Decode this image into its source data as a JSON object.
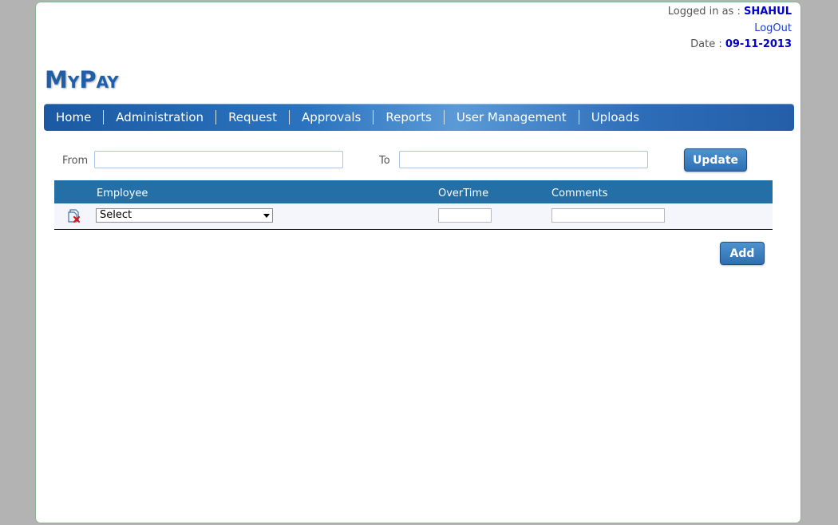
{
  "header": {
    "logged_in_label": "Logged in as : ",
    "username": "SHAHUL",
    "logout_label": "LogOut",
    "date_label": "Date : ",
    "date_value": "09-11-2013"
  },
  "logo": {
    "text": "MyPay"
  },
  "nav": {
    "items": [
      {
        "label": "Home"
      },
      {
        "label": "Administration"
      },
      {
        "label": "Request"
      },
      {
        "label": "Approvals"
      },
      {
        "label": "Reports"
      },
      {
        "label": "User Management"
      },
      {
        "label": "Uploads"
      }
    ]
  },
  "filter": {
    "from_label": "From",
    "from_value": "",
    "to_label": "To",
    "to_value": "",
    "update_label": "Update"
  },
  "grid": {
    "columns": [
      "Employee",
      "OverTime",
      "Comments"
    ],
    "rows": [
      {
        "employee_selected": "Select",
        "overtime": "",
        "comments": ""
      }
    ]
  },
  "actions": {
    "add_label": "Add"
  },
  "colors": {
    "accent": "#236fa6",
    "brand": "#1f5faa",
    "username": "#0000cc"
  },
  "icons": {
    "row_delete": "delete-row-icon"
  }
}
